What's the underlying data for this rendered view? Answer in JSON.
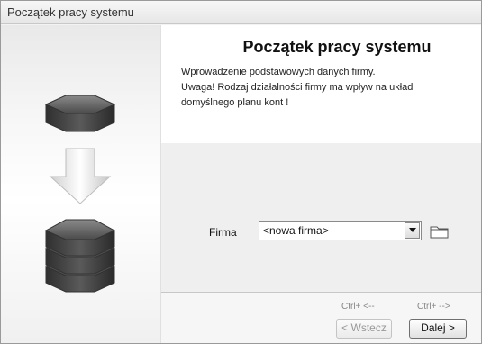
{
  "window": {
    "title": "Początek pracy systemu"
  },
  "content": {
    "heading": "Początek pracy systemu",
    "description_lines": [
      "Wprowadzenie podstawowych danych firmy.",
      "Uwaga! Rodzaj działalności firmy ma wpływ na układ",
      "domyślnego planu kont !"
    ]
  },
  "form": {
    "company_label": "Firma",
    "company_value": "<nowa firma>"
  },
  "footer": {
    "back_shortcut": "Ctrl+ <--",
    "next_shortcut": "Ctrl+ -->",
    "back_label": "< Wstecz",
    "next_label": "Dalej >"
  },
  "icons": [
    "stack-hexagon-icon",
    "down-arrow-icon",
    "chevron-down-icon",
    "folder-icon"
  ]
}
